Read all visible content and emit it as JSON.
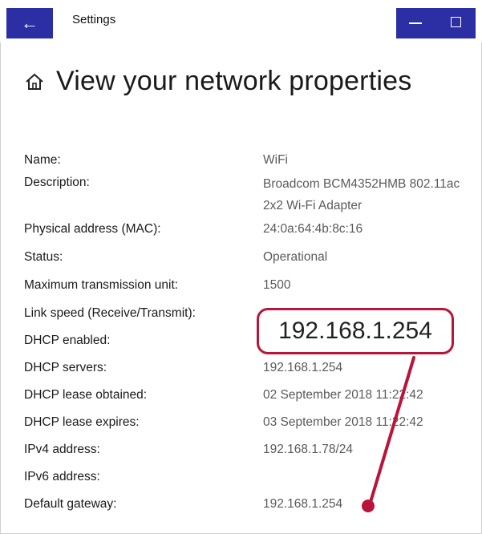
{
  "window": {
    "title": "Settings",
    "back_icon": "arrow-left-icon"
  },
  "page": {
    "title": "View your network properties",
    "icon": "home-icon"
  },
  "properties": [
    {
      "label": "Name:",
      "value": "WiFi"
    },
    {
      "label": "Description:",
      "value": "Broadcom BCM4352HMB 802.11ac 2x2 Wi-Fi Adapter"
    },
    {
      "label": "Physical address (MAC):",
      "value": "24:0a:64:4b:8c:16"
    },
    {
      "label": "Status:",
      "value": "Operational"
    },
    {
      "label": "Maximum transmission unit:",
      "value": "1500"
    },
    {
      "label": "Link speed (Receive/Transmit):",
      "value": ""
    },
    {
      "label": "DHCP enabled:",
      "value": ""
    },
    {
      "label": "DHCP servers:",
      "value": "192.168.1.254"
    },
    {
      "label": "DHCP lease obtained:",
      "value": "02 September 2018 11:22:42"
    },
    {
      "label": "DHCP lease expires:",
      "value": "03 September 2018 11:22:42"
    },
    {
      "label": "IPv4 address:",
      "value": "192.168.1.78/24"
    },
    {
      "label": "IPv6 address:",
      "value": ""
    },
    {
      "label": "Default gateway:",
      "value": "192.168.1.254"
    }
  ],
  "annotation": {
    "callout_text": "192.168.1.254",
    "color": "#b8153a"
  },
  "colors": {
    "titlebar_accent": "#2b2fa3"
  }
}
